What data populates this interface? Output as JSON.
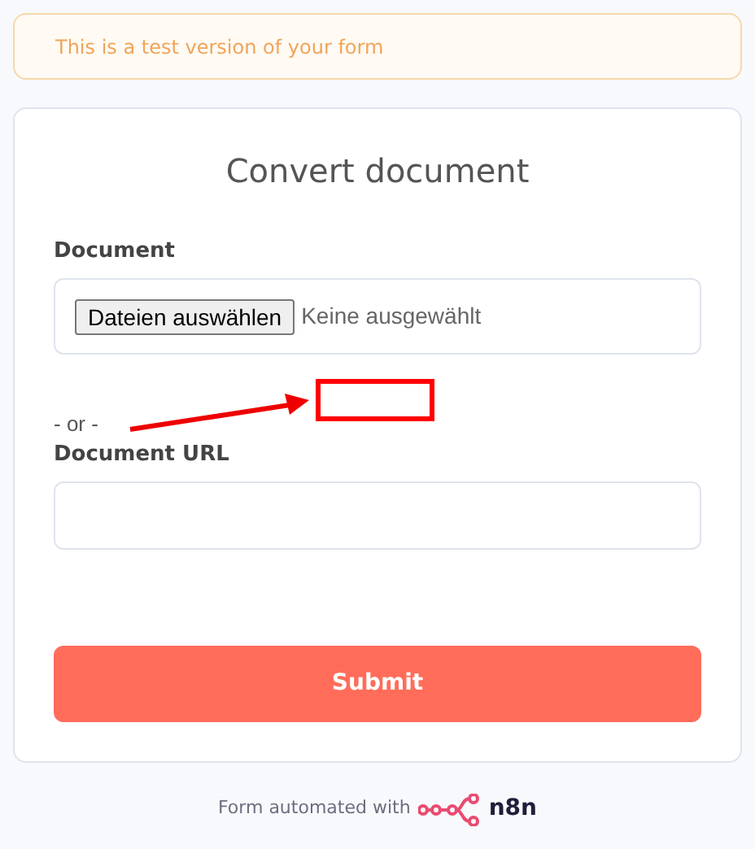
{
  "notice": "This is a test version of your form",
  "form": {
    "title": "Convert document",
    "fields": [
      {
        "kind": "file",
        "label": "Document",
        "button": "Dateien auswählen",
        "status": "Keine ausgewählt"
      },
      {
        "kind": "separator",
        "text": "- or -"
      },
      {
        "kind": "text",
        "label": "Document URL"
      }
    ],
    "submit": "Submit"
  },
  "footer": {
    "text": "Form automated with",
    "brand": "n8n"
  }
}
